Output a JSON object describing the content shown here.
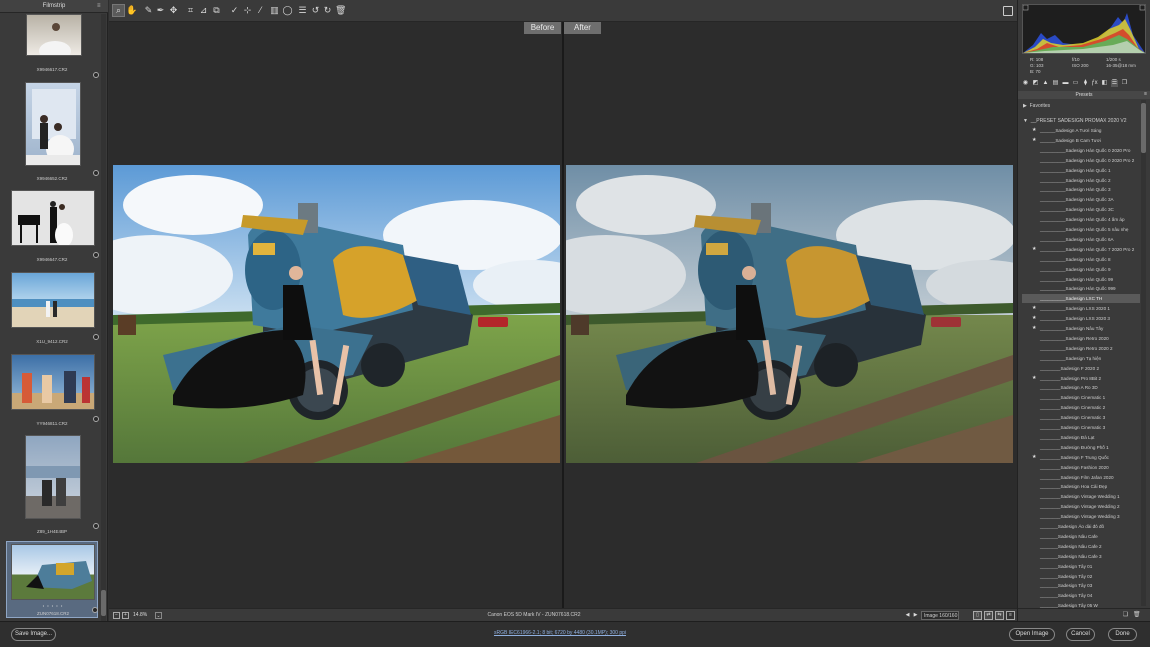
{
  "filmstrip": {
    "title": "Filmstrip",
    "items": [
      {
        "caption": "X9946617.CR2"
      },
      {
        "caption": "X9946652.CR2"
      },
      {
        "caption": "X9946647.CR2"
      },
      {
        "caption": "X1U_9412.CR2"
      },
      {
        "caption": "YY946811.CR2"
      },
      {
        "caption": "Z89_1H4E4BP"
      },
      {
        "caption": "ZUN07618.CR2",
        "stars": "• • • • •"
      }
    ]
  },
  "toolbar": {
    "tools": [
      "zoom-tool",
      "hand-tool",
      "white-balance-tool",
      "color-sampler-tool",
      "targeted-adjustment-tool",
      "crop-tool",
      "straighten-tool",
      "transform-tool",
      "spot-removal-tool",
      "red-eye-tool",
      "adjustment-brush-tool",
      "graduated-filter-tool",
      "radial-filter-tool",
      "preferences",
      "rotate-left",
      "rotate-right",
      "trash"
    ]
  },
  "preview": {
    "before_label": "Before",
    "after_label": "After"
  },
  "status": {
    "zoom": "14.8%",
    "camera": "Canon EOS 5D Mark IV  -  ZUN07618.CR2",
    "image_count": "Image 160/160"
  },
  "histogram": {
    "r_label": "R:",
    "r_value": "108",
    "g_label": "G:",
    "g_value": "103",
    "b_label": "B:",
    "b_value": "70",
    "aperture": "f/10",
    "shutter": "1/200 s",
    "iso": "ISO 200",
    "lens": "16-35@18 mm"
  },
  "presets": {
    "header": "Presets",
    "favorites": "Favorites",
    "group": "__PRESET SADESIGN PROMAX 2020 V2",
    "items": [
      {
        "name": "______Sadesign A Tươi Sáng",
        "star": true
      },
      {
        "name": "______Sadesign B  Cam Tươi",
        "star": true
      },
      {
        "name": "__________Sadesign Hàn Quốc 0 2020 Pro",
        "star": false
      },
      {
        "name": "__________Sadesign Hàn Quốc 0 2020 Pro 2",
        "star": false
      },
      {
        "name": "__________Sadesign Hàn Quốc 1",
        "star": false
      },
      {
        "name": "__________Sadesign Hàn Quốc 2",
        "star": false
      },
      {
        "name": "__________Sadesign Hàn Quốc 3",
        "star": false
      },
      {
        "name": "__________Sadesign Hàn Quốc 3A",
        "star": false
      },
      {
        "name": "__________Sadesign Hàn Quốc 3C",
        "star": false
      },
      {
        "name": "__________Sadesign Hàn Quốc 4 ấm áp",
        "star": false
      },
      {
        "name": "__________Sadesign Hàn Quốc 5 nâu nhẹ",
        "star": false
      },
      {
        "name": "__________Sadesign Hàn Quốc 6A",
        "star": false
      },
      {
        "name": "__________Sadesign Hàn Quốc 7 2020 Pro 2",
        "star": true
      },
      {
        "name": "__________Sadesign Hàn Quốc 8",
        "star": false
      },
      {
        "name": "__________Sadesign Hàn Quốc 9",
        "star": false
      },
      {
        "name": "__________Sadesign Hàn Quốc 99",
        "star": false
      },
      {
        "name": "__________Sadesign Hàn Quốc 999",
        "star": false
      },
      {
        "name": "__________Sadesign LXC  TH",
        "star": false,
        "selected": true
      },
      {
        "name": "__________Sadesign LXS 2020 1",
        "star": true
      },
      {
        "name": "__________Sadesign LXS 2020 3",
        "star": true
      },
      {
        "name": "__________Sadesign Nâu Tây",
        "star": true
      },
      {
        "name": "__________Sadesign Retro 2020",
        "star": false
      },
      {
        "name": "__________Sadesign Retro 2020 2",
        "star": false
      },
      {
        "name": "__________Sadesign Tạ hiện",
        "star": false
      },
      {
        "name": "________Sadesign  F 2020 2",
        "star": false
      },
      {
        "name": "________Sadesign  Pro 8Bit 2",
        "star": true
      },
      {
        "name": "________Sadesign A Ro 3D",
        "star": false
      },
      {
        "name": "________Sadesign Cinematic 1",
        "star": false
      },
      {
        "name": "________Sadesign Cinematic 2",
        "star": false
      },
      {
        "name": "________Sadesign Cinematic 3",
        "star": false
      },
      {
        "name": "________Sadesign Cinematic 3",
        "star": false
      },
      {
        "name": "________Sadesign Đà Lạt",
        "star": false
      },
      {
        "name": "________Sadesign Đường Phố 1",
        "star": false
      },
      {
        "name": "________Sadesign F Trung Quốc",
        "star": true
      },
      {
        "name": "________Sadesign Fashion 2020",
        "star": false
      },
      {
        "name": "________Sadesign Film Jafan 2020",
        "star": false
      },
      {
        "name": "________Sadesign Hoa Cải Đẹp",
        "star": false
      },
      {
        "name": "________Sadesign Vintage Wedding 1",
        "star": false
      },
      {
        "name": "________Sadesign Vintage Wedding 2",
        "star": false
      },
      {
        "name": "________Sadesign Vintage Wedding 3",
        "star": false
      },
      {
        "name": "_______Sadesign Áo dài đỏ đô",
        "star": false
      },
      {
        "name": "_______Sadesign Nâu Cafe",
        "star": false
      },
      {
        "name": "_______Sadesign Nâu Cafe 2",
        "star": false
      },
      {
        "name": "_______Sadesign Nâu Cafe 3",
        "star": false
      },
      {
        "name": "_______Sadesign Tây 01",
        "star": false
      },
      {
        "name": "_______Sadesign Tây 02",
        "star": false
      },
      {
        "name": "_______Sadesign Tây 03",
        "star": false
      },
      {
        "name": "_______Sadesign Tây 04",
        "star": false
      },
      {
        "name": "_______Sadesign Tây 05 W",
        "star": false
      }
    ]
  },
  "footer": {
    "save_label": "Save Image...",
    "workflow": "sRGB IEC61966-2.1; 8 bit; 6720 by 4480 (30.1MP); 300 ppi",
    "open_label": "Open Image",
    "cancel_label": "Cancel",
    "done_label": "Done"
  }
}
